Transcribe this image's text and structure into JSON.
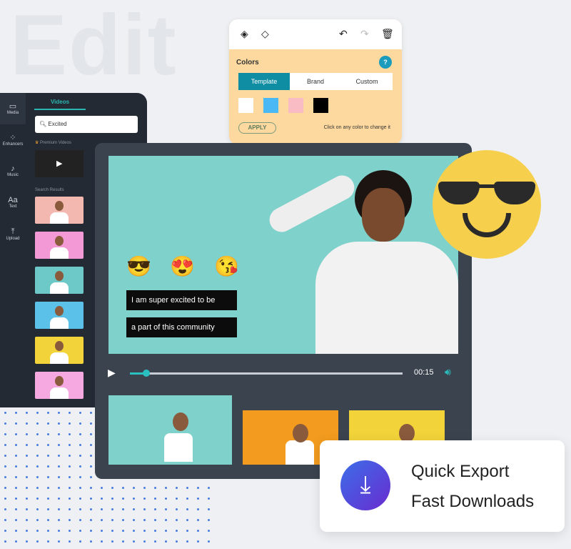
{
  "hero_word": "Edit",
  "sidebar": {
    "rail": [
      {
        "icon": "folder-icon",
        "glyph": "▭",
        "label": "Media"
      },
      {
        "icon": "enhancers-icon",
        "glyph": "⁘",
        "label": "Enhancers"
      },
      {
        "icon": "music-icon",
        "glyph": "♪",
        "label": "Music"
      },
      {
        "icon": "text-icon",
        "glyph": "Aa",
        "label": "Text"
      },
      {
        "icon": "upload-icon",
        "glyph": "⤒",
        "label": "Upload"
      }
    ],
    "tab": "Videos",
    "search_value": "Excited",
    "premium_label": "Premium Videos",
    "results_label": "Search Results",
    "thumb_colors": [
      "#f3b9b0",
      "#f39ad6",
      "#6cc9c7",
      "#5cc1e8",
      "#f2d33a",
      "#f5a9e0"
    ]
  },
  "colors_panel": {
    "title": "Colors",
    "help": "?",
    "tabs": [
      "Template",
      "Brand",
      "Custom"
    ],
    "active_tab": "Template",
    "swatches": [
      "#ffffff",
      "#4ab8f5",
      "#f9bcc4",
      "#000000"
    ],
    "apply": "APPLY",
    "hint": "Click on any color to change it"
  },
  "player": {
    "emojis": [
      "😎",
      "😍",
      "😘"
    ],
    "captions": [
      "I am super excited to be",
      "a part of this community"
    ],
    "time": "00:15",
    "progress": 0.06,
    "clip_colors": [
      "#7fd1cb",
      "#f29b1e",
      "#f2d33a"
    ]
  },
  "export": {
    "line1": "Quick Export",
    "line2": "Fast Downloads"
  }
}
